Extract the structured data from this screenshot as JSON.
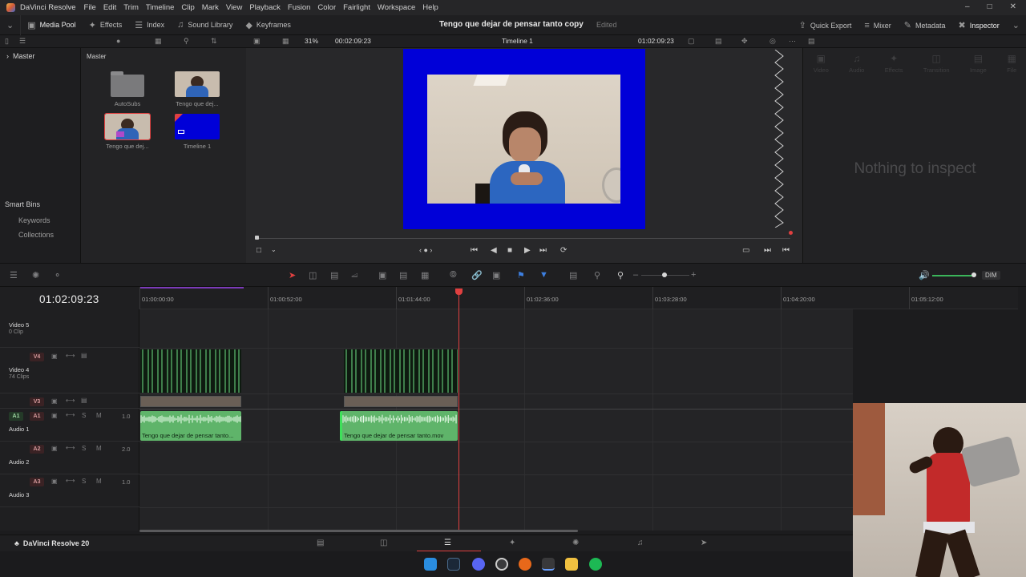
{
  "menubar": {
    "app_name": "DaVinci Resolve",
    "items": [
      "File",
      "Edit",
      "Trim",
      "Timeline",
      "Clip",
      "Mark",
      "View",
      "Playback",
      "Fusion",
      "Color",
      "Fairlight",
      "Workspace",
      "Help"
    ]
  },
  "toolbar": {
    "left": [
      "Media Pool",
      "Effects",
      "Index",
      "Sound Library",
      "Keyframes"
    ],
    "project_title": "Tengo que dejar de pensar tanto copy",
    "status": "Edited",
    "right": [
      "Quick Export",
      "Mixer",
      "Metadata",
      "Inspector"
    ]
  },
  "viewer_bar": {
    "zoom": "31%",
    "source_timecode": "00:02:09:23",
    "timeline_name": "Timeline 1",
    "record_timecode": "01:02:09:23"
  },
  "bins": {
    "master": "Master",
    "smart_bins": "Smart Bins",
    "keywords": "Keywords",
    "collections": "Collections"
  },
  "media_pool": {
    "crumb": "Master",
    "items": [
      "AutoSubs",
      "Tengo que dej...",
      "Tengo que dej...",
      "Timeline 1"
    ]
  },
  "inspector": {
    "tabs": [
      "Video",
      "Audio",
      "Effects",
      "Transition",
      "Image",
      "File"
    ],
    "empty_text": "Nothing to inspect"
  },
  "timeline": {
    "timecode": "01:02:09:23",
    "ruler": [
      "01:00:00:00",
      "01:00:52:00",
      "01:01:44:00",
      "01:02:36:00",
      "01:03:28:00",
      "01:04:20:00",
      "01:05:12:00"
    ],
    "volume_label": "DIM",
    "tracks": {
      "v5_name": "Video 5",
      "v5_sub": "0 Clip",
      "v4_badge": "V4",
      "v4_name": "Video 4",
      "v4_sub": "74 Clips",
      "v3_badge": "V3",
      "a1_src": "A1",
      "a1_badge": "A1",
      "a1_name": "Audio 1",
      "a1_vol": "1.0",
      "a2_badge": "A2",
      "a2_name": "Audio 2",
      "a2_vol": "2.0",
      "a3_badge": "A3",
      "a3_name": "Audio 3",
      "a3_vol": "1.0",
      "solo": "S",
      "mute": "M"
    },
    "audio_clips": [
      "Tengo que dejar de pensar tanto...",
      "Tengo que dejar de pensar tanto.mov"
    ]
  },
  "bottombar": {
    "brand": "DaVinci Resolve 20"
  },
  "colors": {
    "accent_red": "#e04040",
    "clip_green": "#5fb46a",
    "viewer_blue": "#0000d8"
  }
}
